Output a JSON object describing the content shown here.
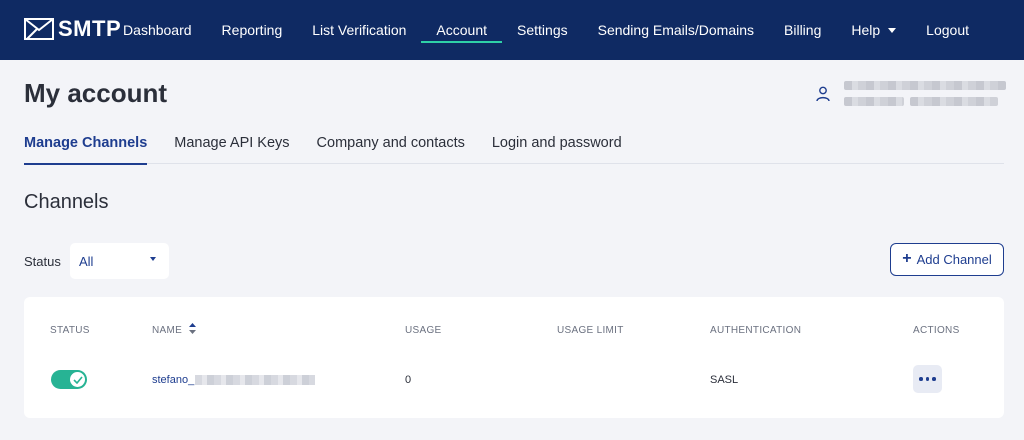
{
  "navbar": {
    "logo_text": "SMTP",
    "items": [
      {
        "label": "Dashboard"
      },
      {
        "label": "Reporting"
      },
      {
        "label": "List Verification"
      },
      {
        "label": "Account",
        "active": true
      },
      {
        "label": "Settings"
      },
      {
        "label": "Sending Emails/Domains"
      },
      {
        "label": "Billing"
      },
      {
        "label": "Help",
        "dropdown": true
      },
      {
        "label": "Logout"
      }
    ]
  },
  "header": {
    "title": "My account",
    "user_icon": "user-icon"
  },
  "tabs": [
    {
      "label": "Manage Channels",
      "active": true
    },
    {
      "label": "Manage API Keys"
    },
    {
      "label": "Company and contacts"
    },
    {
      "label": "Login and password"
    }
  ],
  "section": {
    "title": "Channels",
    "filter": {
      "label": "Status",
      "value": "All"
    },
    "add_button": {
      "label": "Add Channel",
      "icon": "plus-icon"
    }
  },
  "table": {
    "columns": [
      "STATUS",
      "NAME",
      "USAGE",
      "USAGE LIMIT",
      "AUTHENTICATION",
      "ACTIONS"
    ],
    "rows": [
      {
        "status_enabled": true,
        "name": "stefano_",
        "usage": "0",
        "usage_limit": "",
        "authentication": "SASL",
        "actions_icon": "more-horizontal-icon"
      }
    ]
  },
  "colors": {
    "navbar_bg": "#0f2a63",
    "accent_green": "#27b394",
    "nav_underline": "#2fd0a7",
    "primary_blue": "#1e3d8f",
    "page_bg": "#f3f4f8"
  }
}
